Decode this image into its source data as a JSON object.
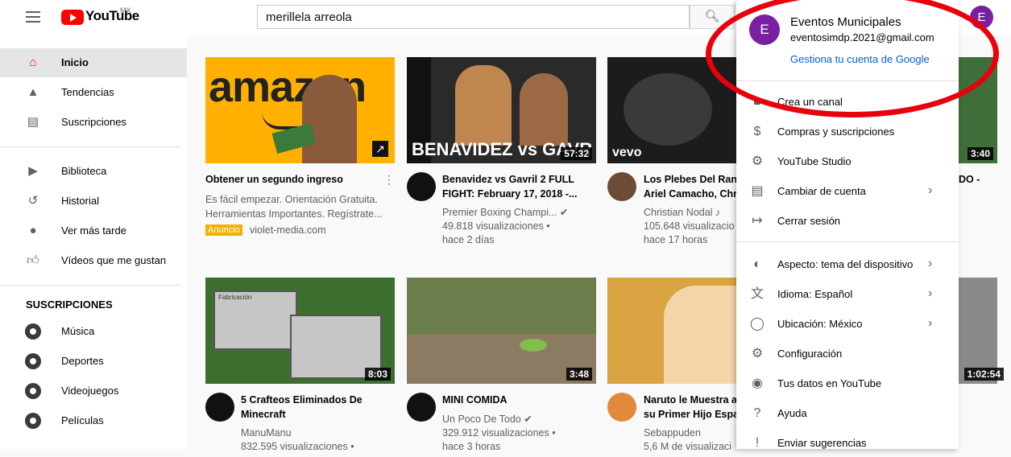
{
  "header": {
    "logo_text": "YouTube",
    "region": "MX",
    "search_value": "merillela arreola",
    "avatar_letter": "E"
  },
  "sidebar": {
    "main": [
      {
        "label": "Inicio",
        "icon": "home-icon",
        "active": true
      },
      {
        "label": "Tendencias",
        "icon": "flame-icon"
      },
      {
        "label": "Suscripciones",
        "icon": "subscriptions-icon"
      }
    ],
    "library": [
      {
        "label": "Biblioteca",
        "icon": "library-icon"
      },
      {
        "label": "Historial",
        "icon": "history-icon"
      },
      {
        "label": "Ver más tarde",
        "icon": "clock-icon"
      },
      {
        "label": "Vídeos que me gustan",
        "icon": "thumbs-up-icon"
      }
    ],
    "subs_title": "SUSCRIPCIONES",
    "subs": [
      {
        "label": "Música"
      },
      {
        "label": "Deportes"
      },
      {
        "label": "Videojuegos"
      },
      {
        "label": "Películas"
      }
    ]
  },
  "videos": [
    {
      "title1": "Obtener un segundo ingreso",
      "title2": "",
      "meta1": "Es fácil empezar. Orientación Gratuita.",
      "meta2": "Herramientas Importantes. Regístrate...",
      "badge": "Anuncio",
      "meta3": "violet-media.com",
      "thumb_text": "amazon",
      "duration": ""
    },
    {
      "title1": "Benavidez vs Gavril 2 FULL",
      "title2": "FIGHT: February 17, 2018 -...",
      "meta1": "Premier Boxing Champi... ✔",
      "meta2": "49.818 visualizaciones •",
      "meta3": "hace 2 días",
      "thumb_text": "BENAVIDEZ vs GAVR",
      "duration": "57:32"
    },
    {
      "title1": "Los Plebes Del Ranc",
      "title2": "Ariel Camacho, Chri",
      "meta1": "Christian Nodal ♪",
      "meta2": "105.648 visualizacio",
      "meta3": "hace 17 horas",
      "thumb_text": "vevo",
      "duration": ""
    },
    {
      "title1": "5 Crafteos Eliminados De",
      "title2": "Minecraft",
      "meta1": "ManuManu",
      "meta2": "832.595 visualizaciones •",
      "meta3": "",
      "thumb_text": "Fabricación",
      "duration": "8:03"
    },
    {
      "title1": "MINI COMIDA",
      "title2": "",
      "meta1": "Un Poco De Todo ✔",
      "meta2": "329.912 visualizaciones •",
      "meta3": "hace 3 horas",
      "thumb_text": "",
      "duration": "3:48"
    },
    {
      "title1": "Naruto le Muestra a",
      "title2": "su Primer Hijo Espa",
      "meta1": "Sebappuden",
      "meta2": "5,6 M de visualizaci",
      "meta3": "",
      "thumb_text": "",
      "duration": ""
    }
  ],
  "right_edge": {
    "dur1": "3:40",
    "dur2": "1:02:54",
    "text1": "DO -"
  },
  "account_menu": {
    "name": "Eventos Municipales",
    "email": "eventosimdp.2021@gmail.com",
    "manage": "Gestiona tu cuenta de Google",
    "group1": [
      {
        "label": "Crea un canal",
        "icon": "create-channel-icon"
      },
      {
        "label": "Compras y suscripciones",
        "icon": "dollar-icon"
      },
      {
        "label": "YouTube Studio",
        "icon": "studio-gear-icon"
      },
      {
        "label": "Cambiar de cuenta",
        "icon": "switch-account-icon",
        "chevron": true
      },
      {
        "label": "Cerrar sesión",
        "icon": "sign-out-icon"
      }
    ],
    "group2": [
      {
        "label": "Aspecto: tema del dispositivo",
        "icon": "theme-icon",
        "chevron": true
      },
      {
        "label": "Idioma: Español",
        "icon": "language-icon",
        "chevron": true
      },
      {
        "label": "Ubicación: México",
        "icon": "globe-icon",
        "chevron": true
      },
      {
        "label": "Configuración",
        "icon": "settings-icon"
      },
      {
        "label": "Tus datos en YouTube",
        "icon": "shield-icon"
      },
      {
        "label": "Ayuda",
        "icon": "help-icon"
      },
      {
        "label": "Enviar sugerencias",
        "icon": "feedback-icon"
      }
    ]
  },
  "colors": {
    "brand_red": "#ff0000",
    "avatar_purple": "#7b1fa2",
    "link_blue": "#065fd4",
    "annotation_red": "#e8000c"
  }
}
